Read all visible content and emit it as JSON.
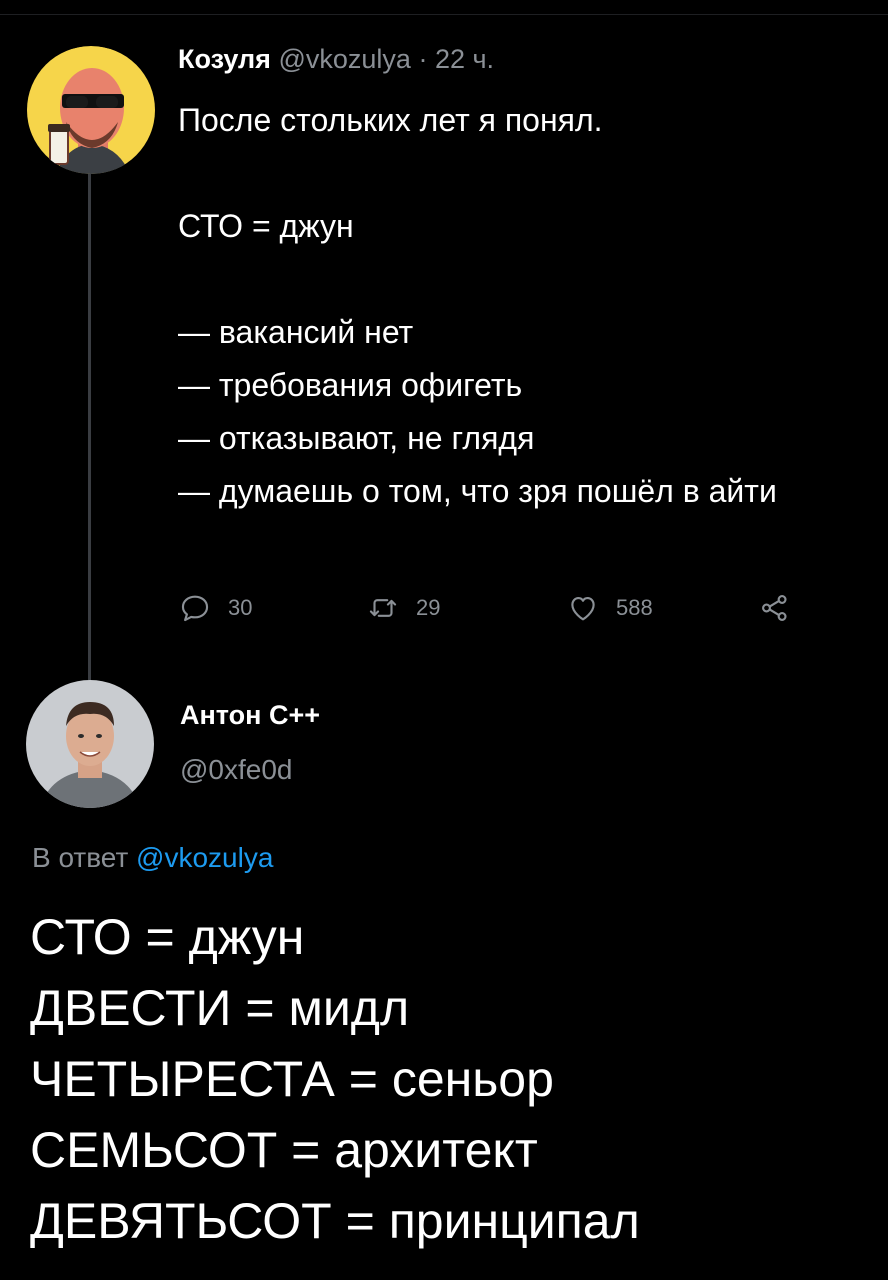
{
  "tweet": {
    "author_name": "Козуля",
    "author_handle": "@vkozulya",
    "separator": "·",
    "time": "22 ч.",
    "text": "После стольких лет я понял.\n\nСТО = джун\n\n— вакансий нет\n— требования офигеть\n— отказывают, не глядя\n— думаешь о том, что зря пошёл в айти",
    "actions": {
      "replies": "30",
      "retweets": "29",
      "likes": "588"
    },
    "icons": [
      "reply-icon",
      "retweet-icon",
      "like-icon",
      "share-icon"
    ]
  },
  "reply": {
    "author_name": "Антон С++",
    "author_handle": "@0xfe0d",
    "reply_to_label": "В ответ",
    "reply_to_handle": "@vkozulya",
    "text": "СТО = джун\nДВЕСТИ = мидл\nЧЕТЫРЕСТА = сеньор\nСЕМЬСОТ = архитект\nДЕВЯТЬСОТ = принципал"
  },
  "colors": {
    "background": "#000000",
    "text": "#ffffff",
    "muted": "#8b9096",
    "link": "#1d9bf0",
    "avatar_bg": "#f6d54a"
  }
}
